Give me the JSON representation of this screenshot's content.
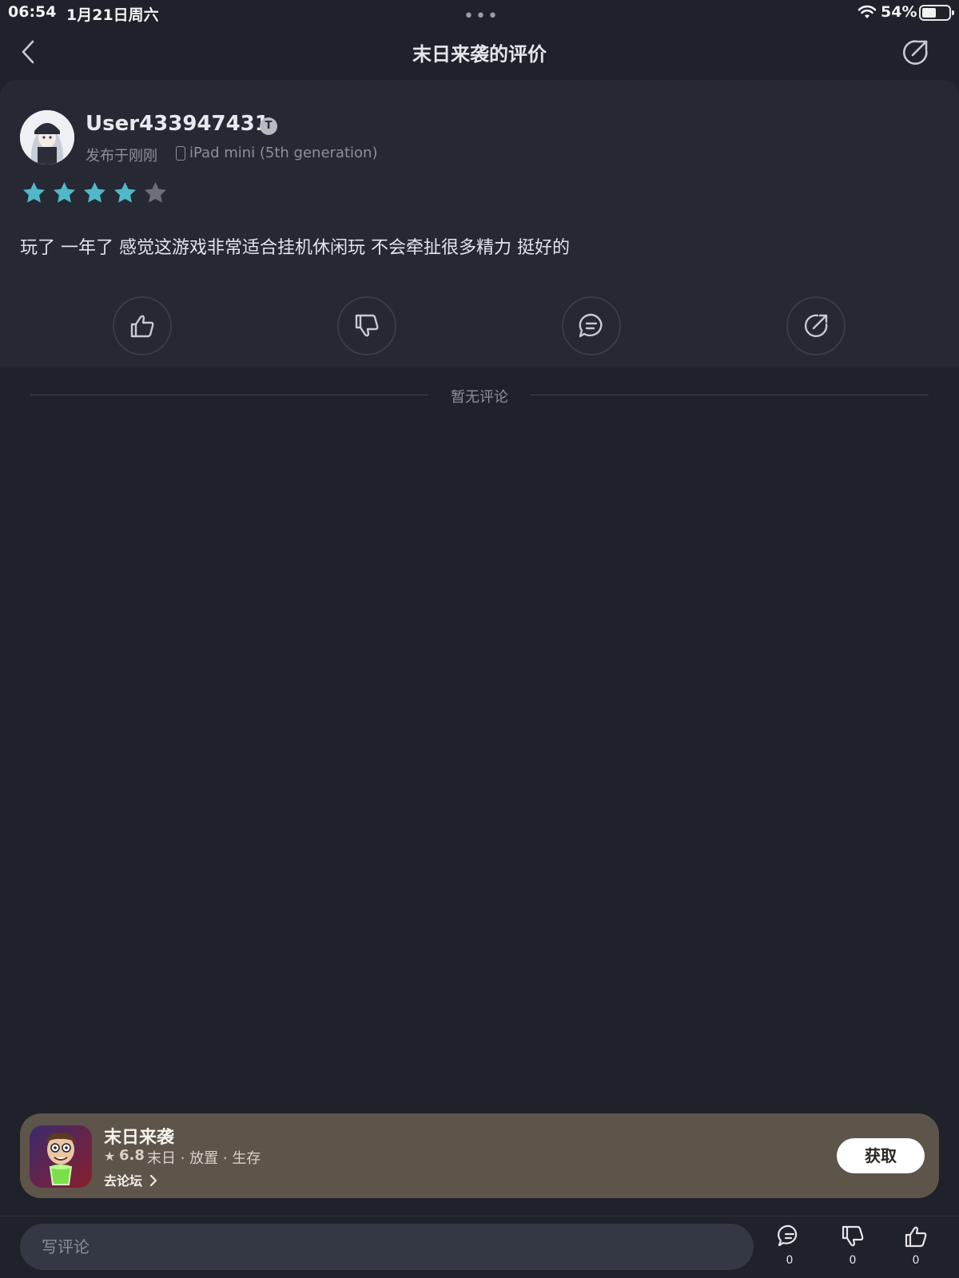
{
  "status_bar": {
    "time": "06:54",
    "date": "1月21日周六",
    "multitask_dots": "•••",
    "battery_percent": "54%",
    "battery_level": 0.54
  },
  "header": {
    "title": "末日来袭的评价",
    "back_icon": "chevron-left-icon",
    "share_icon": "share-icon"
  },
  "review": {
    "username": "User433947431",
    "badge_letter": "T",
    "posted": "发布于刚刚",
    "device": "iPad mini (5th generation)",
    "rating": 4,
    "rating_max": 5,
    "star_color": "#4fb9c9",
    "star_empty_color": "#6c6e78",
    "text": "玩了 一年了  感觉这游戏非常适合挂机休闲玩  不会牵扯很多精力 挺好的",
    "actions": [
      {
        "icon": "thumbs-up-icon"
      },
      {
        "icon": "thumbs-down-icon"
      },
      {
        "icon": "comment-icon"
      },
      {
        "icon": "share-icon"
      }
    ]
  },
  "comments": {
    "empty_label": "暂无评论"
  },
  "app_banner": {
    "name": "末日来袭",
    "rating": "6.8",
    "tags": "末日 · 放置 · 生存",
    "forum_link": "去论坛",
    "get_label": "获取",
    "background_color": "#5d544a"
  },
  "bottom_bar": {
    "input_placeholder": "写评论",
    "comment_count": "0",
    "dislike_count": "0",
    "like_count": "0"
  }
}
